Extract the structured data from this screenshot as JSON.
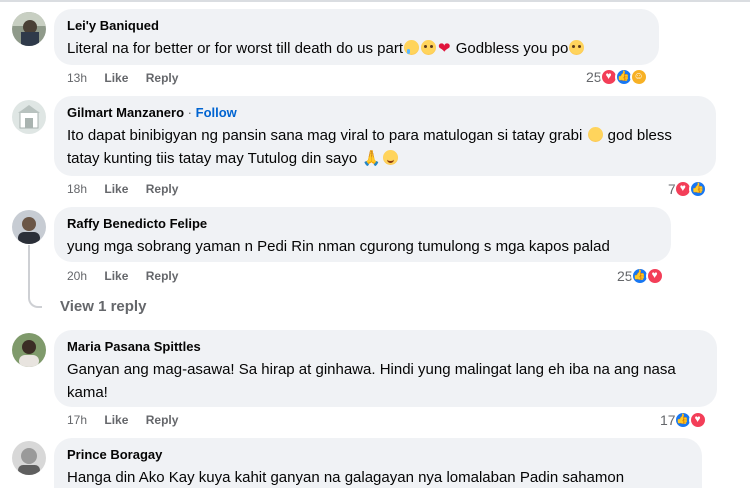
{
  "comments": [
    {
      "author": "Lei'y Baniqued",
      "text": "Literal na for better or for worst till death do us part",
      "text_after_heart": " Godbless you po",
      "time": "13h",
      "like_label": "Like",
      "reply_label": "Reply",
      "reaction_count": "25",
      "reactions": [
        "love",
        "like",
        "care"
      ],
      "emojis": [
        "crying-face",
        "pleading-face",
        "red-heart",
        "pleading-face"
      ]
    },
    {
      "author": "Gilmart Manzanero",
      "follow_label": "Follow",
      "separator": "·",
      "text": "Ito dapat binibigyan ng pansin sana mag viral to para matulogan si tatay grabi",
      "text_line2": " god bless tatay kunting tiis tatay may Tutulog din sayo",
      "time": "18h",
      "like_label": "Like",
      "reply_label": "Reply",
      "reaction_count": "7",
      "reactions": [
        "love",
        "like"
      ],
      "emojis": [
        "sad-face",
        "folded-hands",
        "smiling-face"
      ]
    },
    {
      "author": "Raffy Benedicto Felipe",
      "text": "yung mga sobrang yaman n Pedi Rin nman cgurong tumulong s mga kapos palad",
      "time": "20h",
      "like_label": "Like",
      "reply_label": "Reply",
      "reaction_count": "25",
      "reactions": [
        "like",
        "love"
      ],
      "view_replies": "View 1 reply"
    },
    {
      "author": "Maria Pasana Spittles",
      "text": "Ganyan ang mag-asawa! Sa hirap at ginhawa. Hindi yung malingat lang eh iba na ang nasa kama!",
      "time": "17h",
      "like_label": "Like",
      "reply_label": "Reply",
      "reaction_count": "17",
      "reactions": [
        "like",
        "love"
      ]
    },
    {
      "author": "Prince Boragay",
      "text": "Hanga din Ako Kay kuya kahit ganyan na galagayan nya lomalaban Padin sahamon"
    }
  ],
  "colors": {
    "bubble": "#f0f2f5",
    "meta": "#65676b",
    "follow": "#0064d1",
    "love": "#f33e58",
    "like": "#1877f2",
    "care": "#f7b125"
  }
}
